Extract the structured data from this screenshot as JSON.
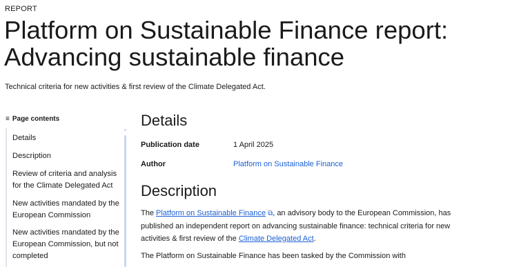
{
  "page": {
    "eyebrow": "REPORT",
    "title": "Platform on Sustainable Finance report: Advancing sustainable finance",
    "subtitle": "Technical criteria for new activities & first review of the Climate Delegated Act."
  },
  "toc": {
    "heading": "Page contents",
    "icon": "list-icon",
    "items": [
      "Details",
      "Description",
      "Review of criteria and analysis for the Climate Delegated Act",
      "New activities mandated by the European Commission",
      "New activities mandated by the European Commission, but not completed"
    ]
  },
  "details": {
    "heading": "Details",
    "publication_date_label": "Publication date",
    "publication_date_value": "1 April 2025",
    "author_label": "Author",
    "author_value": "Platform on Sustainable Finance"
  },
  "description": {
    "heading": "Description",
    "p1_pre": "The ",
    "p1_link1": "Platform on Sustainable Finance",
    "p1_mid": ", an advisory body to the European Commission, has published an independent report on advancing sustainable finance: technical criteria for new activities & first review of the ",
    "p1_link2": "Climate Delegated Act",
    "p1_end": ".",
    "p2": "The Platform on Sustainable Finance has been tasked by the Commission with"
  },
  "colors": {
    "link": "#1a5fd6",
    "text": "#1a1a1a",
    "toc_border": "#dfe3ea"
  }
}
